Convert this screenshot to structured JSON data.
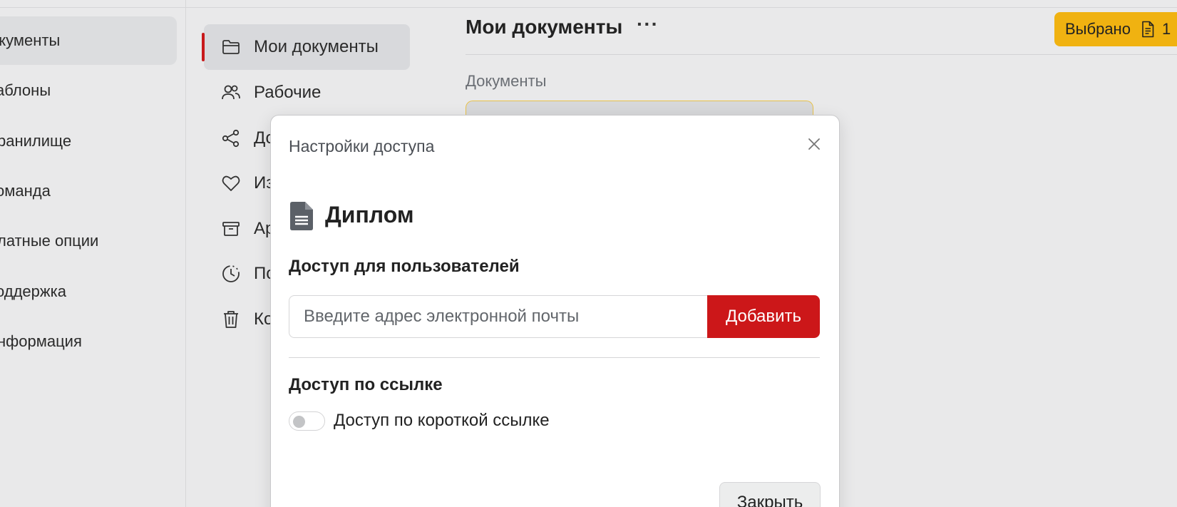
{
  "sidebar": {
    "items": [
      {
        "label": "окументы",
        "active": true
      },
      {
        "label": "аблоны"
      },
      {
        "label": "ранилище"
      },
      {
        "label": "оманда"
      },
      {
        "label": "латные опции"
      },
      {
        "label": "оддержка"
      },
      {
        "label": "нформация"
      }
    ]
  },
  "nav": {
    "items": [
      {
        "label": "Мои документы",
        "icon": "folder-icon",
        "active": true
      },
      {
        "label": "Рабочие",
        "icon": "users-icon"
      },
      {
        "label": "До",
        "icon": "share-icon"
      },
      {
        "label": "Из",
        "icon": "heart-icon"
      },
      {
        "label": "Ар",
        "icon": "archive-icon"
      },
      {
        "label": "По",
        "icon": "clock-icon"
      },
      {
        "label": "Ко",
        "icon": "trash-icon"
      }
    ]
  },
  "main": {
    "title": "Мои документы",
    "more": "···",
    "section_label": "Документы",
    "selected": {
      "label": "Выбрано",
      "count": "1"
    }
  },
  "modal": {
    "title": "Настройки доступа",
    "document_name": "Диплом",
    "users_heading": "Доступ для пользователей",
    "email_placeholder": "Введите адрес электронной почты",
    "add_label": "Добавить",
    "link_heading": "Доступ по ссылке",
    "short_link_label": "Доступ по короткой ссылке",
    "short_link_enabled": false,
    "close_label": "Закрыть"
  },
  "colors": {
    "accent_red": "#cc1719",
    "badge_yellow": "#f0b211",
    "background": "#e9e9ea"
  }
}
